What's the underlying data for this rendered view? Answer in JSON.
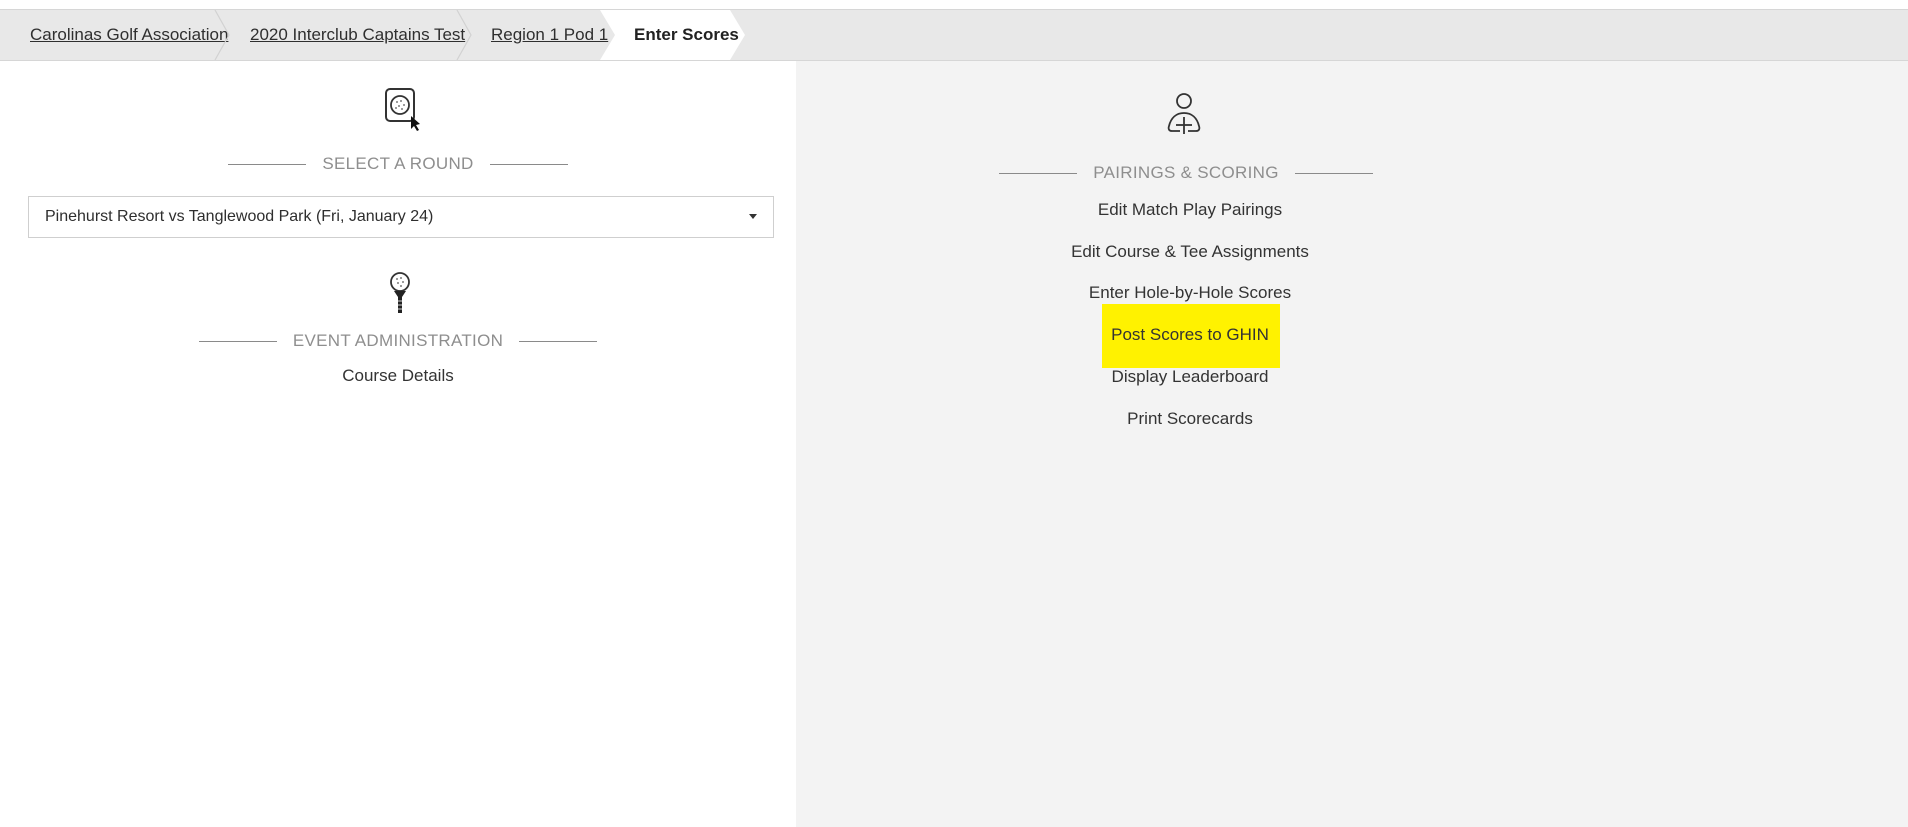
{
  "breadcrumb": {
    "items": [
      {
        "label": "Carolinas Golf Association"
      },
      {
        "label": "2020 Interclub Captains Test"
      },
      {
        "label": "Region 1 Pod 1"
      },
      {
        "label": "Enter Scores"
      }
    ]
  },
  "left": {
    "select_round": {
      "heading": "SELECT A ROUND",
      "icon": "golf-ball-cursor-icon",
      "selected": "Pinehurst Resort vs Tanglewood Park (Fri, January 24)"
    },
    "event_admin": {
      "heading": "EVENT ADMINISTRATION",
      "icon": "golf-tee-icon",
      "links": [
        {
          "label": "Course Details"
        }
      ]
    }
  },
  "right": {
    "pairings": {
      "heading": "PAIRINGS & SCORING",
      "icon": "add-person-icon",
      "links": [
        {
          "label": "Edit Match Play Pairings"
        },
        {
          "label": "Edit Course & Tee Assignments"
        },
        {
          "label": "Enter Hole-by-Hole Scores"
        },
        {
          "label": "Post Scores to GHIN"
        },
        {
          "label": "Display Leaderboard"
        },
        {
          "label": "Print Scorecards"
        }
      ]
    }
  },
  "colors": {
    "highlight": "#fff200",
    "breadcrumb_bg": "#e8e8e8",
    "active_crumb_bg": "#ffffff",
    "right_panel_bg": "#f3f3f3"
  }
}
